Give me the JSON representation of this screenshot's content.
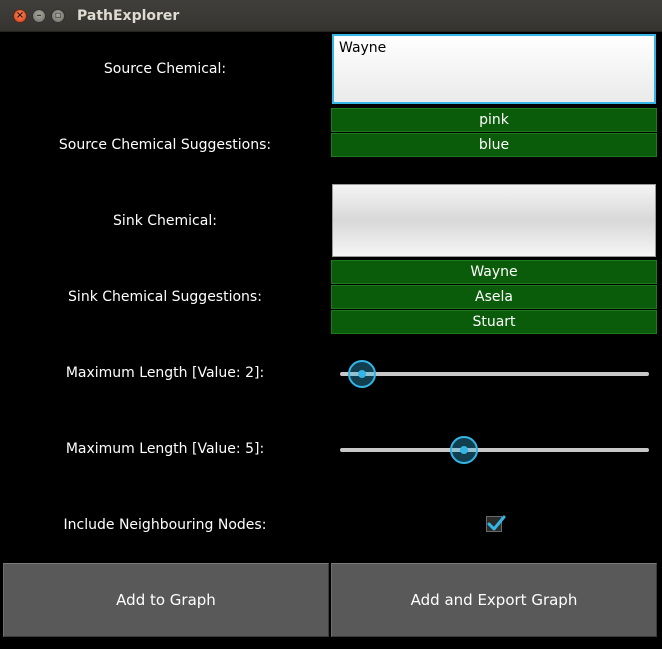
{
  "window": {
    "title": "PathExplorer",
    "close_glyph": "×",
    "minimize_glyph": "–",
    "maximize_glyph": "▫"
  },
  "source": {
    "label": "Source Chemical:",
    "value": "Wayne",
    "suggestions_label": "Source Chemical Suggestions:",
    "suggestions": [
      "pink",
      "blue"
    ]
  },
  "sink": {
    "label": "Sink Chemical:",
    "value": "",
    "suggestions_label": "Sink Chemical Suggestions:",
    "suggestions": [
      "Wayne",
      "Asela",
      "Stuart"
    ]
  },
  "sliders": [
    {
      "label": "Maximum Length [Value: 2]:",
      "value": 2,
      "fraction": 0.07
    },
    {
      "label": "Maximum Length [Value: 5]:",
      "value": 5,
      "fraction": 0.4
    }
  ],
  "neighbours": {
    "label": "Include Neighbouring Nodes:",
    "checked": true
  },
  "buttons": {
    "add": "Add to Graph",
    "add_export": "Add and Export Graph"
  },
  "colors": {
    "accent": "#33b5e5",
    "suggestion_bg": "#0a5c0a",
    "button_bg": "#595959"
  }
}
